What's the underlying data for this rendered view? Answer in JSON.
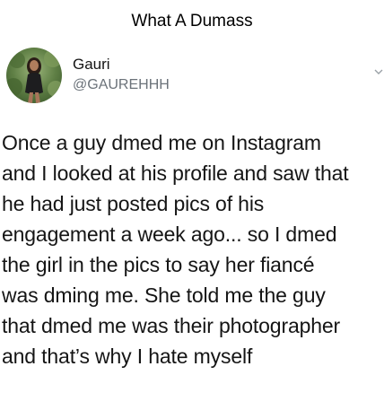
{
  "caption": "What A Dumass",
  "tweet": {
    "author": {
      "display_name": "Gauri",
      "handle": "@GAUREHHH"
    },
    "more_icon": "chevron-down-icon",
    "text_lines": [
      "Once a guy dmed me on Instagram",
      "and I looked at his profile and saw that",
      "he had just posted pics of his",
      "engagement a week ago... so I dmed",
      "the girl in the pics to say her fiancé",
      "was dming me. She told me the guy",
      "that dmed me was their photographer",
      "and that’s why I hate myself"
    ]
  },
  "colors": {
    "background": "#ffffff",
    "text": "#151515",
    "handle": "#6b7279"
  }
}
